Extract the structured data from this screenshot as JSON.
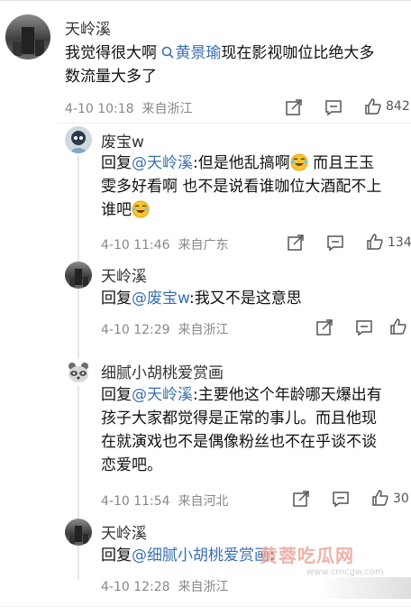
{
  "comments": [
    {
      "user": "天岭溪",
      "text_before": "我觉得很大啊 ",
      "search_mention": "黄景瑜",
      "text_after_line1": "现在影视咖位比绝大多",
      "text_line2": "数流量大多了",
      "date": "4-10 10:18",
      "location": "来自浙江",
      "likes": "842"
    },
    {
      "user": "废宝w",
      "reply_label": "回复",
      "mention": "@天岭溪",
      "line1": ":但是他乱搞啊",
      "line1b": " 而且王玉",
      "line2": "雯多好看啊 也不是说看谁咖位大酒配不上",
      "line3": "谁吧",
      "date": "4-10 11:46",
      "location": "来自广东",
      "likes": "134"
    },
    {
      "user": "天岭溪",
      "reply_label": "回复",
      "mention": "@废宝w",
      "line1": ":我又不是这意思",
      "date": "4-10 12:29",
      "location": "来自浙江"
    },
    {
      "user": "细腻小胡桃爱赏画",
      "reply_label": "回复",
      "mention": "@天岭溪",
      "line1": ":主要他这个年龄哪天爆出有",
      "line2": "孩子大家都觉得是正常的事儿。而且他现",
      "line3": "在就演戏也不是偶像粉丝也不在乎谈不谈",
      "line4": "恋爱吧。",
      "date": "4-10 11:54",
      "location": "来自河北",
      "likes": "30"
    },
    {
      "user": "天岭溪",
      "reply_label": "回复",
      "mention": "@细腻小胡桃爱赏画",
      "line1": ":",
      "date": "4-10 12:28",
      "location": "来自浙江"
    }
  ],
  "watermark": {
    "text": "黄蓉吃瓜网",
    "url": "www.cmcgw.com"
  },
  "colors": {
    "mention": "#3a6fb0",
    "meta": "#888888",
    "watermark": "#e8a59a"
  }
}
